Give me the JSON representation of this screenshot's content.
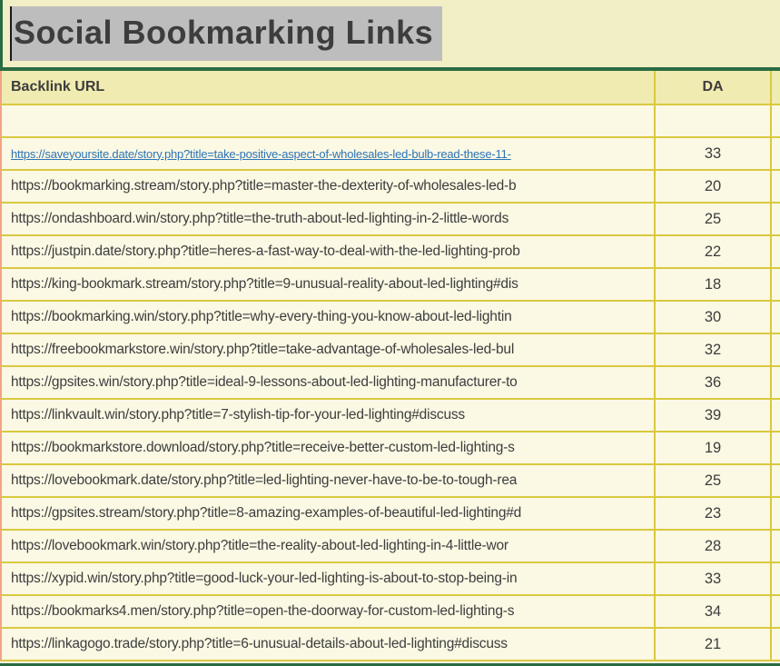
{
  "title": {
    "text": "Social Bookmarking Links"
  },
  "table": {
    "columns": [
      {
        "label": "Backlink URL"
      },
      {
        "label": "DA"
      }
    ],
    "rows": [
      {
        "url": "",
        "da": "",
        "link": false
      },
      {
        "url": "https://saveyoursite.date/story.php?title=take-positive-aspect-of-wholesales-led-bulb-read-these-11-",
        "da": "33",
        "link": true
      },
      {
        "url": "https://bookmarking.stream/story.php?title=master-the-dexterity-of-wholesales-led-b",
        "da": "20",
        "link": false
      },
      {
        "url": "https://ondashboard.win/story.php?title=the-truth-about-led-lighting-in-2-little-words",
        "da": "25",
        "link": false
      },
      {
        "url": "https://justpin.date/story.php?title=heres-a-fast-way-to-deal-with-the-led-lighting-prob",
        "da": "22",
        "link": false
      },
      {
        "url": "https://king-bookmark.stream/story.php?title=9-unusual-reality-about-led-lighting#dis",
        "da": "18",
        "link": false
      },
      {
        "url": "https://bookmarking.win/story.php?title=why-every-thing-you-know-about-led-lightin",
        "da": "30",
        "link": false
      },
      {
        "url": "https://freebookmarkstore.win/story.php?title=take-advantage-of-wholesales-led-bul",
        "da": "32",
        "link": false
      },
      {
        "url": "https://gpsites.win/story.php?title=ideal-9-lessons-about-led-lighting-manufacturer-to",
        "da": "36",
        "link": false
      },
      {
        "url": "https://linkvault.win/story.php?title=7-stylish-tip-for-your-led-lighting#discuss",
        "da": "39",
        "link": false
      },
      {
        "url": "https://bookmarkstore.download/story.php?title=receive-better-custom-led-lighting-s",
        "da": "19",
        "link": false
      },
      {
        "url": "https://lovebookmark.date/story.php?title=led-lighting-never-have-to-be-to-tough-rea",
        "da": "25",
        "link": false
      },
      {
        "url": "https://gpsites.stream/story.php?title=8-amazing-examples-of-beautiful-led-lighting#d",
        "da": "23",
        "link": false
      },
      {
        "url": "https://lovebookmark.win/story.php?title=the-reality-about-led-lighting-in-4-little-wor",
        "da": "28",
        "link": false
      },
      {
        "url": "https://xypid.win/story.php?title=good-luck-your-led-lighting-is-about-to-stop-being-in",
        "da": "33",
        "link": false
      },
      {
        "url": "https://bookmarks4.men/story.php?title=open-the-doorway-for-custom-led-lighting-s",
        "da": "34",
        "link": false
      },
      {
        "url": "https://linkagogo.trade/story.php?title=6-unusual-details-about-led-lighting#discuss",
        "da": "21",
        "link": false
      }
    ]
  },
  "colors": {
    "title_bg": "#f2eec6",
    "header_bg": "#f0ebb0",
    "row_bg": "#fbf8e4",
    "green": "#2a6b42",
    "olive": "#d9c93f",
    "salmon": "#f1a386",
    "link_blue": "#2e74b5",
    "text": "#3d3d3d",
    "selection": "#bdbdbd",
    "cursor": "#1a1a1a"
  }
}
